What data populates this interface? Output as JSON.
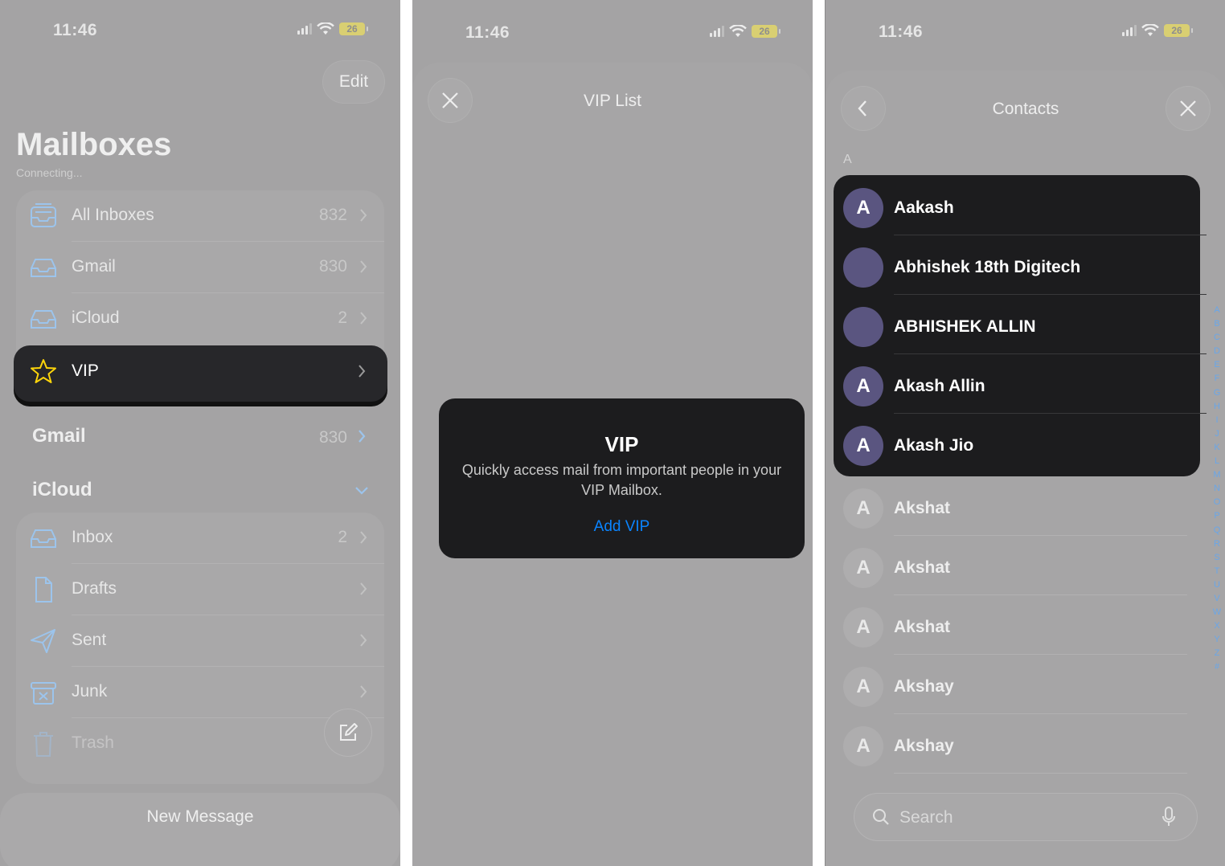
{
  "status": {
    "time": "11:46",
    "battery": "26"
  },
  "mailboxes": {
    "edit_label": "Edit",
    "title": "Mailboxes",
    "subtitle": "Connecting...",
    "top_items": [
      {
        "label": "All Inboxes",
        "count": "832",
        "icon": "tray-stack-icon"
      },
      {
        "label": "Gmail",
        "count": "830",
        "icon": "tray-icon"
      },
      {
        "label": "iCloud",
        "count": "2",
        "icon": "tray-icon"
      }
    ],
    "vip": {
      "label": "VIP",
      "icon": "star-icon",
      "accent": "#ffd60a"
    },
    "gmail_section": {
      "label": "Gmail",
      "count": "830"
    },
    "icloud_section": {
      "label": "iCloud"
    },
    "icloud_items": [
      {
        "label": "Inbox",
        "count": "2",
        "icon": "tray-icon"
      },
      {
        "label": "Drafts",
        "count": "",
        "icon": "document-icon"
      },
      {
        "label": "Sent",
        "count": "",
        "icon": "paperplane-icon"
      },
      {
        "label": "Junk",
        "count": "",
        "icon": "junk-icon"
      },
      {
        "label": "Trash",
        "count": "",
        "icon": "trash-icon"
      }
    ],
    "new_message_label": "New Message"
  },
  "vip_list": {
    "title": "VIP List",
    "card_title": "VIP",
    "card_description": "Quickly access mail from important people in your VIP Mailbox.",
    "add_label": "Add VIP",
    "link_color": "#0a84ff"
  },
  "contacts": {
    "title": "Contacts",
    "section_letter": "A",
    "highlighted": [
      {
        "name": "Aakash",
        "initial": "A",
        "avatar": "initial"
      },
      {
        "name": "Abhishek 18th Digitech",
        "initial": "",
        "avatar": "photo"
      },
      {
        "name": "ABHISHEK ALLIN",
        "initial": "",
        "avatar": "photo"
      },
      {
        "name": "Akash Allin",
        "initial": "A",
        "avatar": "initial"
      },
      {
        "name": "Akash Jio",
        "initial": "A",
        "avatar": "initial"
      }
    ],
    "others": [
      {
        "name": "Akshat",
        "initial": "A"
      },
      {
        "name": "Akshat",
        "initial": "A"
      },
      {
        "name": "Akshat",
        "initial": "A"
      },
      {
        "name": "Akshay",
        "initial": "A"
      },
      {
        "name": "Akshay",
        "initial": "A"
      }
    ],
    "index_letters": [
      "A",
      "B",
      "C",
      "D",
      "E",
      "F",
      "G",
      "H",
      "I",
      "J",
      "K",
      "L",
      "M",
      "N",
      "O",
      "P",
      "Q",
      "R",
      "S",
      "T",
      "U",
      "V",
      "W",
      "X",
      "Y",
      "Z",
      "#"
    ],
    "search_placeholder": "Search"
  }
}
